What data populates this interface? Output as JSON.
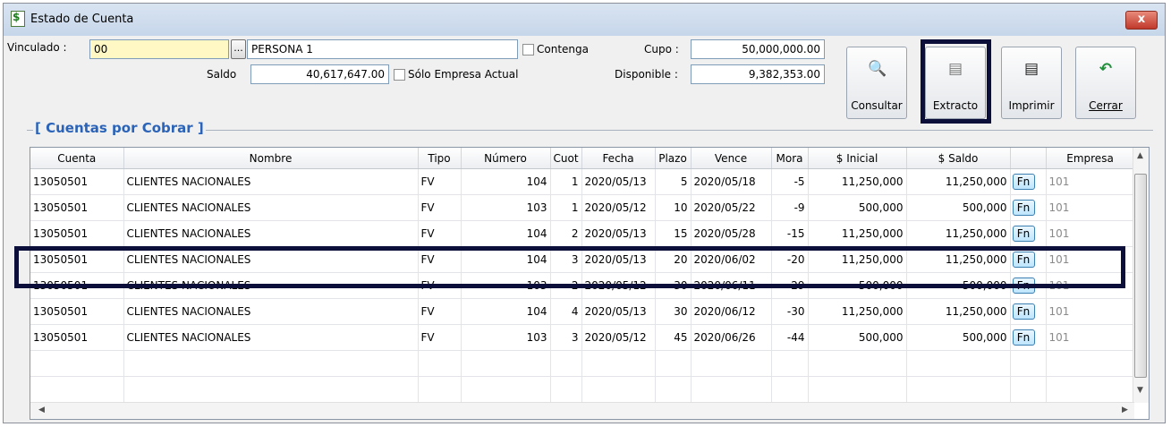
{
  "window": {
    "title": "Estado de Cuenta",
    "close": "x"
  },
  "form": {
    "vinculado_label": "Vinculado :",
    "vinculado_value": "00",
    "dots": "...",
    "persona_value": "PERSONA 1",
    "contenga_label": "Contenga",
    "saldo_label": "Saldo",
    "saldo_value": "40,617,647.00",
    "solo_empresa_label": "Sólo Empresa Actual",
    "cupo_label": "Cupo :",
    "cupo_value": "50,000,000.00",
    "disponible_label": "Disponible :",
    "disponible_value": "9,382,353.00"
  },
  "toolbar": {
    "consultar": "Consultar",
    "extracto": "Extracto",
    "imprimir": "Imprimir",
    "cerrar": "Cerrar"
  },
  "group": {
    "title": "[ Cuentas por Cobrar ]"
  },
  "table": {
    "columns": [
      "Cuenta",
      "Nombre",
      "Tipo",
      "Número",
      "Cuot",
      "Fecha",
      "Plazo",
      "Vence",
      "Mora",
      "$ Inicial",
      "$ Saldo",
      "",
      "Empresa"
    ],
    "rows": [
      [
        "13050501",
        "CLIENTES NACIONALES",
        "FV",
        "104",
        "1",
        "2020/05/13",
        "5",
        "2020/05/18",
        "-5",
        "11,250,000",
        "11,250,000",
        "Fn",
        "101"
      ],
      [
        "13050501",
        "CLIENTES NACIONALES",
        "FV",
        "103",
        "1",
        "2020/05/12",
        "10",
        "2020/05/22",
        "-9",
        "500,000",
        "500,000",
        "Fn",
        "101"
      ],
      [
        "13050501",
        "CLIENTES NACIONALES",
        "FV",
        "104",
        "2",
        "2020/05/13",
        "15",
        "2020/05/28",
        "-15",
        "11,250,000",
        "11,250,000",
        "Fn",
        "101"
      ],
      [
        "13050501",
        "CLIENTES NACIONALES",
        "FV",
        "104",
        "3",
        "2020/05/13",
        "20",
        "2020/06/02",
        "-20",
        "11,250,000",
        "11,250,000",
        "Fn",
        "101"
      ],
      [
        "13050501",
        "CLIENTES NACIONALES",
        "FV",
        "103",
        "2",
        "2020/05/12",
        "30",
        "2020/06/11",
        "-29",
        "500,000",
        "500,000",
        "Fn",
        "101"
      ],
      [
        "13050501",
        "CLIENTES NACIONALES",
        "FV",
        "104",
        "4",
        "2020/05/13",
        "30",
        "2020/06/12",
        "-30",
        "11,250,000",
        "11,250,000",
        "Fn",
        "101"
      ],
      [
        "13050501",
        "CLIENTES NACIONALES",
        "FV",
        "103",
        "3",
        "2020/05/12",
        "45",
        "2020/06/26",
        "-44",
        "500,000",
        "500,000",
        "Fn",
        "101"
      ]
    ],
    "selected_row": 3
  }
}
